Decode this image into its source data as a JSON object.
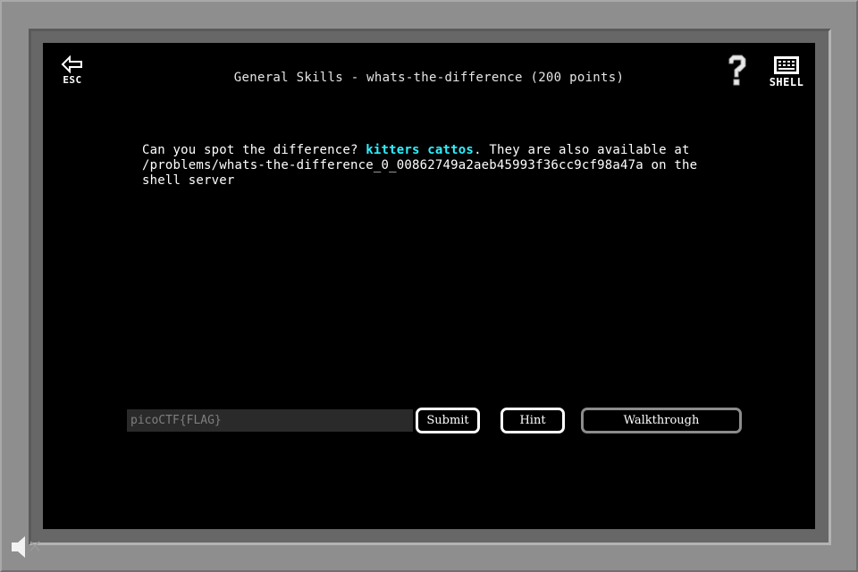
{
  "window": {
    "title": "General Skills - whats-the-difference (200 points)"
  },
  "toolbar": {
    "esc_label": "ESC",
    "shell_label": "SHELL",
    "help_icon": "question-mark-icon",
    "back_icon": "arrow-left-icon",
    "shell_icon": "terminal-icon"
  },
  "problem": {
    "text_before": "Can you spot the difference? ",
    "link_kitters": "kitters",
    "link_cattos": "cattos",
    "text_after": ". They are also available at /problems/whats-the-difference_0_00862749a2aeb45993f36cc9cf98a47a on the shell server"
  },
  "form": {
    "flag_placeholder": "picoCTF{FLAG}",
    "flag_value": "",
    "submit_label": "Submit",
    "hint_label": "Hint",
    "walkthrough_label": "Walkthrough"
  },
  "footer": {
    "volume_icon": "speaker-muted-icon"
  },
  "colors": {
    "screen_bg": "#000000",
    "link": "#2ff0ff",
    "frame": "#8e8e8e"
  }
}
